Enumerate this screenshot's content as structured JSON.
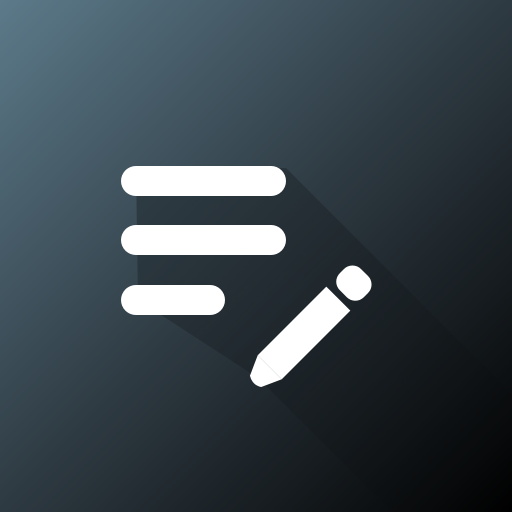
{
  "icon": {
    "name": "notes-edit-icon",
    "glyph_color": "#FFFFFF",
    "background_gradient": [
      "#5C7A8A",
      "#2E3A42",
      "#000000"
    ],
    "long_shadow_color": "#000000"
  }
}
